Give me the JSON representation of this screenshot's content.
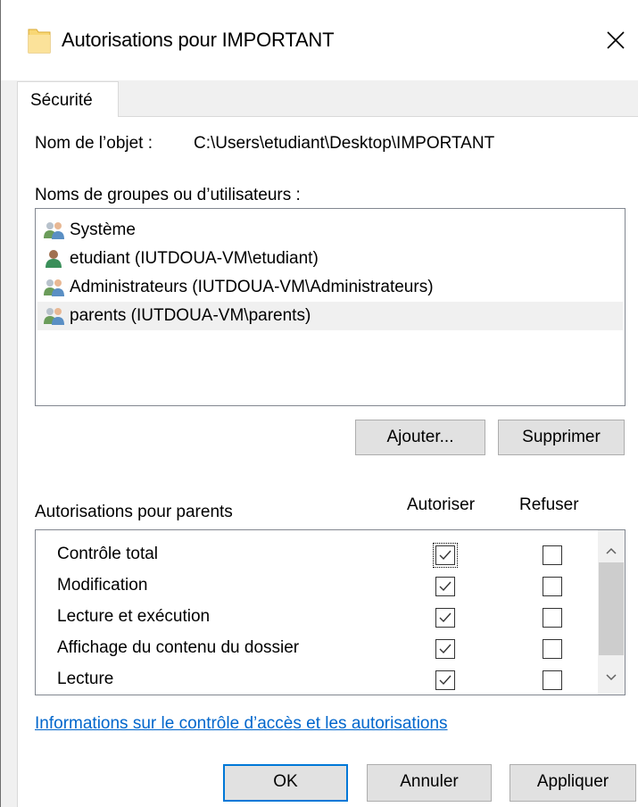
{
  "window": {
    "title": "Autorisations pour IMPORTANT",
    "close_glyph": "✕"
  },
  "tabs": [
    {
      "label": "Sécurité",
      "active": true
    }
  ],
  "object": {
    "label": "Nom de l’objet :",
    "value": "C:\\Users\\etudiant\\Desktop\\IMPORTANT"
  },
  "groups": {
    "label": "Noms de groupes ou d’utilisateurs :",
    "items": [
      {
        "name": "Système",
        "icon": "group-icon",
        "selected": false
      },
      {
        "name": "etudiant (IUTDOUA-VM\\etudiant)",
        "icon": "user-icon",
        "selected": false
      },
      {
        "name": "Administrateurs (IUTDOUA-VM\\Administrateurs)",
        "icon": "group-icon",
        "selected": false
      },
      {
        "name": "parents (IUTDOUA-VM\\parents)",
        "icon": "group-icon",
        "selected": true
      }
    ]
  },
  "group_buttons": {
    "add": "Ajouter...",
    "remove": "Supprimer"
  },
  "permissions": {
    "title": "Autorisations pour parents",
    "allow_header": "Autoriser",
    "deny_header": "Refuser",
    "rows": [
      {
        "name": "Contrôle total",
        "allow": true,
        "deny": false
      },
      {
        "name": "Modification",
        "allow": true,
        "deny": false
      },
      {
        "name": "Lecture et exécution",
        "allow": true,
        "deny": false
      },
      {
        "name": "Affichage du contenu du dossier",
        "allow": true,
        "deny": false
      },
      {
        "name": "Lecture",
        "allow": true,
        "deny": false
      }
    ]
  },
  "link": "Informations sur le contrôle d’accès et les autorisations",
  "footer_buttons": {
    "ok": "OK",
    "cancel": "Annuler",
    "apply": "Appliquer"
  },
  "colors": {
    "accent": "#0078d7",
    "link": "#0066cc",
    "selection": "#f0f0f0"
  }
}
